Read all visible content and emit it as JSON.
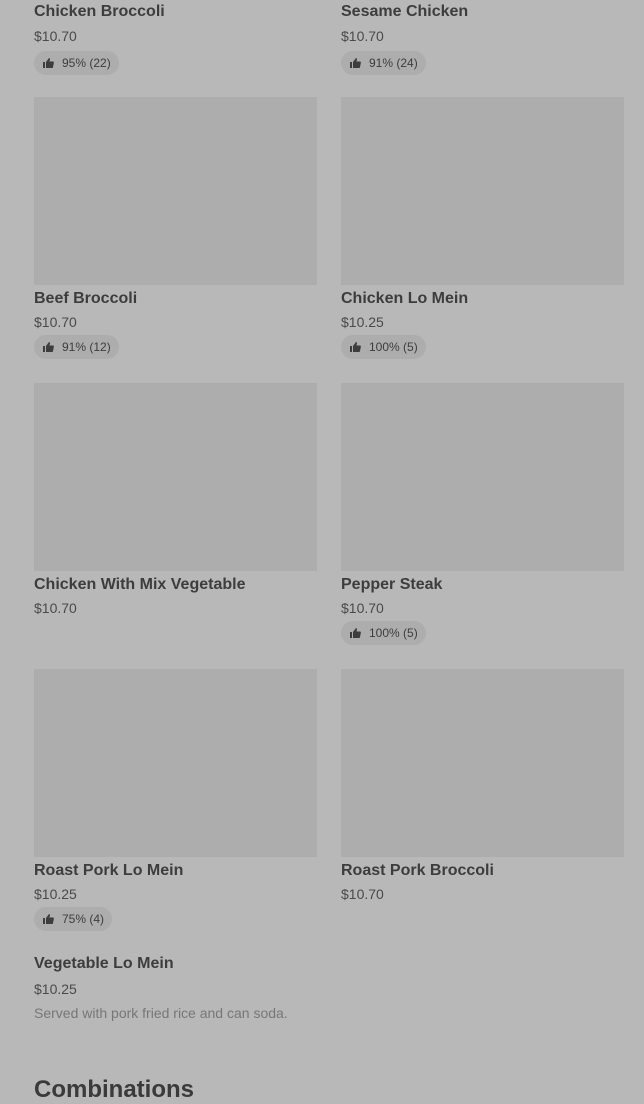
{
  "items": [
    {
      "name": "Chicken Broccoli",
      "price": "$10.70",
      "rating": "95% (22)"
    },
    {
      "name": "Sesame Chicken",
      "price": "$10.70",
      "rating": "91% (24)"
    },
    {
      "name": "Beef Broccoli",
      "price": "$10.70",
      "rating": "91% (12)"
    },
    {
      "name": "Chicken Lo Mein",
      "price": "$10.25",
      "rating": "100% (5)"
    },
    {
      "name": "Chicken With Mix Vegetable",
      "price": "$10.70"
    },
    {
      "name": "Pepper Steak",
      "price": "$10.70",
      "rating": "100% (5)"
    },
    {
      "name": "Roast Pork Lo Mein",
      "price": "$10.25",
      "rating": "75% (4)"
    },
    {
      "name": "Roast Pork Broccoli",
      "price": "$10.70"
    },
    {
      "name": "Vegetable Lo Mein",
      "price": "$10.25",
      "description": "Served with pork fried rice and can soda."
    }
  ],
  "section": {
    "title": "Combinations"
  },
  "icons": {
    "rating": "thumbs-up-icon"
  },
  "colors": {
    "overlay_background": "#b8b8b8",
    "image_placeholder": "#adadad"
  }
}
